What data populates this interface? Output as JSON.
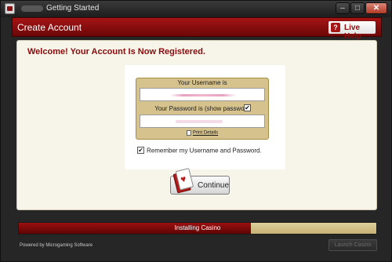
{
  "window": {
    "title": "Getting Started",
    "minimize": "–",
    "maximize": "□",
    "close": "✕"
  },
  "header": {
    "title": "Create Account",
    "live_help_label": "Live Help",
    "live_help_icon": "?"
  },
  "main": {
    "welcome": "Welcome! Your Account Is Now Registered.",
    "username_label": "Your Username is",
    "password_label": "Your Password is (show password",
    "show_password_checked": true,
    "check_mark": "✔",
    "print_details": "Print Details",
    "remember_label": "Remember my Username and Password.",
    "remember_checked": true,
    "continue_label": "Continue",
    "card_suit": "♥"
  },
  "progress": {
    "label": "Installing Casino",
    "value": 0.65
  },
  "footer": {
    "powered_by": "Powered by Microgaming Software",
    "launch_label": "Launch Casino"
  },
  "colors": {
    "brand_red": "#a41414",
    "panel_gold": "#d6c28c"
  },
  "icons": [
    "app-icon",
    "live-help-icon",
    "print-icon",
    "card-icon"
  ]
}
